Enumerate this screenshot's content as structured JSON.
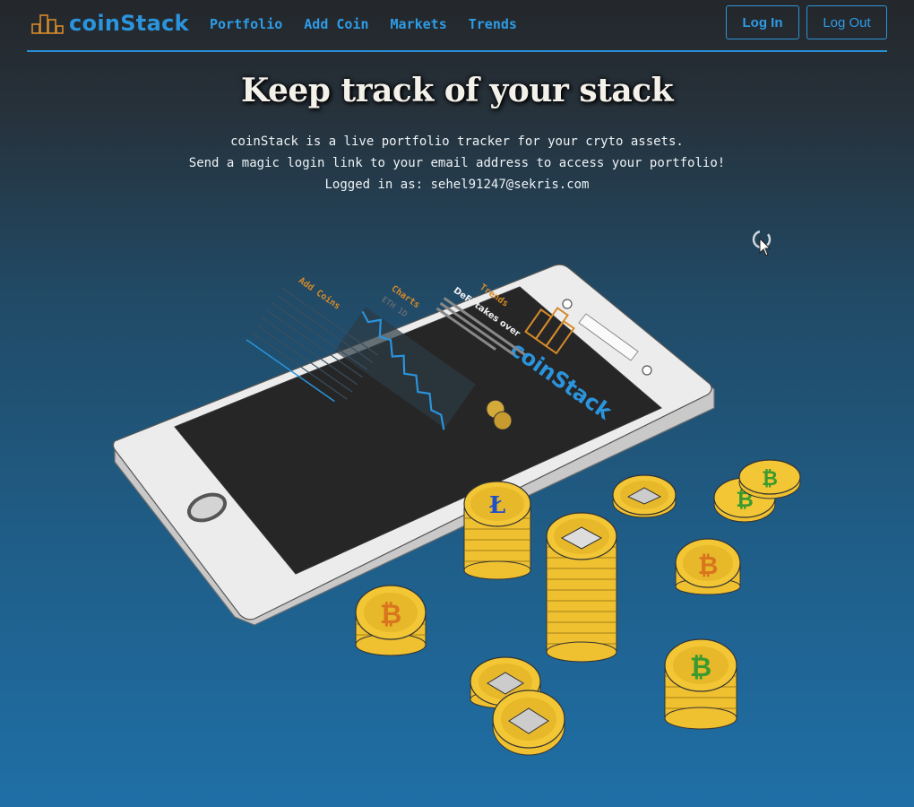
{
  "nav": {
    "brand": "coinStack",
    "links": [
      "Portfolio",
      "Add Coin",
      "Markets",
      "Trends"
    ],
    "login_label": "Log In",
    "logout_label": "Log Out"
  },
  "hero": {
    "title": "Keep track of your stack",
    "line1": "coinStack is a live portfolio tracker for your cryto assets.",
    "line2": "Send a magic login link to your email address to access your portfolio!",
    "line3": "Logged in as: sehel91247@sekris.com"
  },
  "illustration": {
    "screen_brand": "coinStack",
    "screen_trends": "Trends",
    "screen_headline": "DeFi takes over",
    "screen_charts": "Charts",
    "screen_chart_label": "ETH 1D",
    "screen_add_coins": "Add Coins",
    "coin_icons": [
      "bitcoin-icon",
      "ethereum-icon",
      "litecoin-icon"
    ]
  },
  "colors": {
    "accent": "#2e9ce6",
    "coin_gold": "#e8b820",
    "brand_orange": "#d58a2a"
  }
}
